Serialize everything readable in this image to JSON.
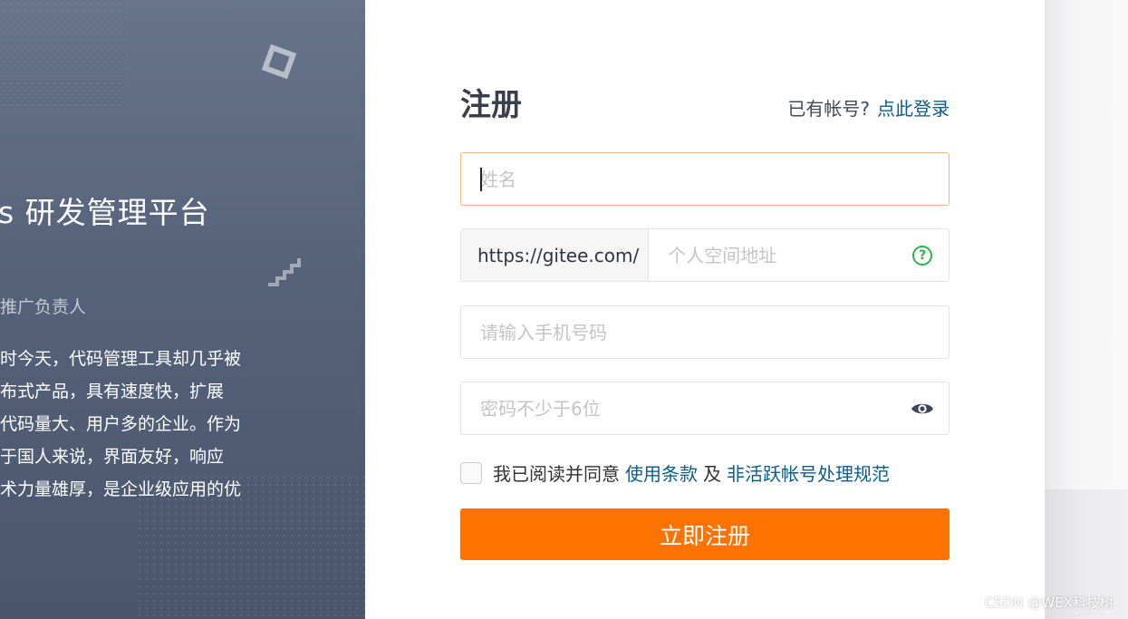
{
  "promo": {
    "title": "s 研发管理平台",
    "subtitle": "推广负责人",
    "body_lines": [
      "时今天，代码管理工具却几乎被",
      "布式产品，具有速度快，扩展",
      "代码量大、用户多的企业。作为",
      "于国人来说，界面友好，响应",
      "术力量雄厚，是企业级应用的优"
    ]
  },
  "form": {
    "title": "注册",
    "login_hint_text": "已有帐号?",
    "login_link": "点此登录",
    "name_placeholder": "姓名",
    "url_prefix": "https://gitee.com/",
    "space_placeholder": "个人空间地址",
    "help_icon_glyph": "?",
    "phone_placeholder": "请输入手机号码",
    "password_placeholder": "密码不少于6位",
    "agree_text": "我已阅读并同意",
    "terms_link": "使用条款",
    "and_text": "及",
    "inactive_policy_link": "非活跃帐号处理规范",
    "submit_label": "立即注册"
  },
  "watermark": "CSDN @WEX科技树",
  "colors": {
    "accent_orange": "#fe7300",
    "link_blue": "#0b5d8a",
    "help_green": "#2bb24c",
    "focus_border": "#f7b77b"
  },
  "icons": {
    "help": "question-circle-icon",
    "password_toggle": "eye-icon"
  }
}
